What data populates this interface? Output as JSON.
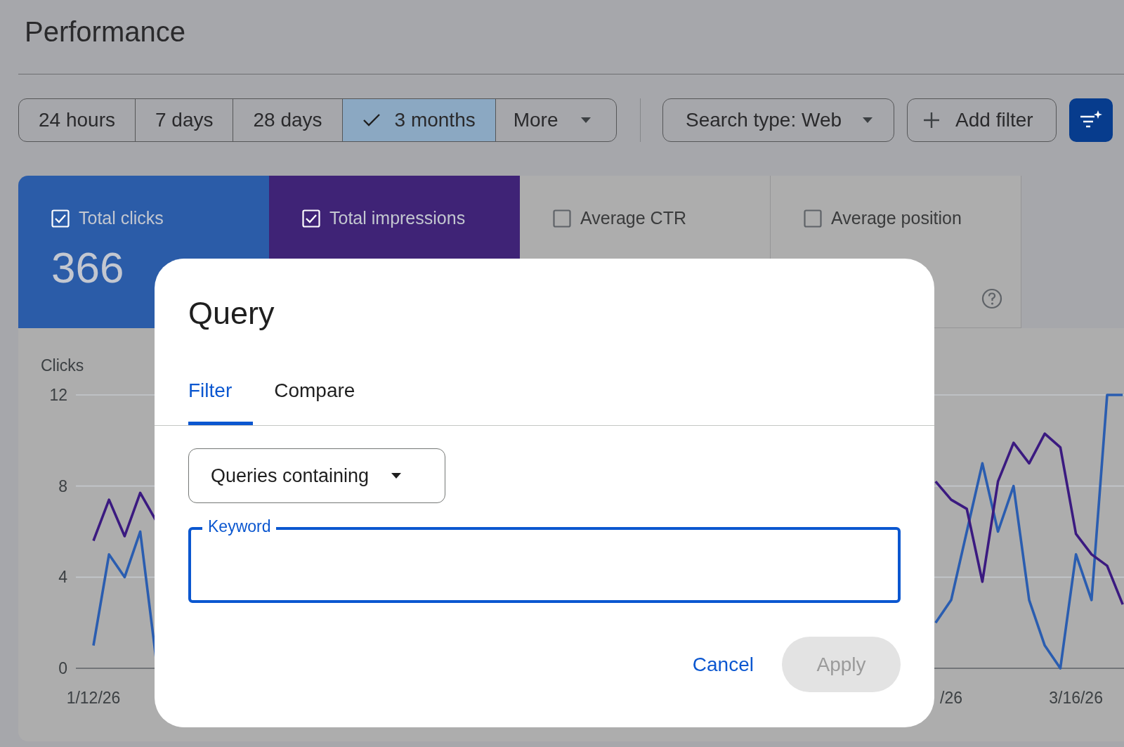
{
  "page": {
    "title": "Performance"
  },
  "date_ranges": [
    {
      "label": "24 hours",
      "selected": false
    },
    {
      "label": "7 days",
      "selected": false
    },
    {
      "label": "28 days",
      "selected": false
    },
    {
      "label": "3 months",
      "selected": true
    }
  ],
  "more_button": {
    "label": "More"
  },
  "search_type": {
    "label": "Search type: Web"
  },
  "add_filter": {
    "label": "Add filter"
  },
  "metrics": [
    {
      "label": "Total clicks",
      "checked": true,
      "value": "366",
      "color": "#2b5ca8",
      "help": false
    },
    {
      "label": "Total impressions",
      "checked": true,
      "color": "#3f2376",
      "help": false
    },
    {
      "label": "Average CTR",
      "checked": false,
      "help": false
    },
    {
      "label": "Average position",
      "checked": false,
      "help": true
    }
  ],
  "chart": {
    "chart_data": {
      "type": "line",
      "ylabel": "Clicks",
      "ylim": [
        0,
        12
      ],
      "yticks": [
        0,
        4,
        8,
        12
      ],
      "categories": [
        "1/12/26",
        null,
        null,
        null,
        null,
        null,
        null,
        null,
        null,
        null,
        null,
        null,
        null,
        null,
        null,
        null,
        null,
        null,
        null,
        null,
        null,
        null,
        null,
        null,
        null,
        null,
        null,
        null,
        null,
        null,
        null,
        null,
        null,
        null,
        null,
        null,
        null,
        null,
        null,
        null,
        null,
        null,
        null,
        null,
        null,
        null,
        null,
        null,
        null,
        null,
        null,
        null,
        null,
        null,
        null,
        "/26",
        null,
        null,
        null,
        null,
        null,
        null,
        null,
        "3/16/26",
        null,
        null,
        null
      ],
      "series": [
        {
          "color": "#2a5db0",
          "values": [
            1,
            5,
            4,
            6,
            0.5,
            null,
            null,
            null,
            null,
            null,
            null,
            null,
            null,
            null,
            null,
            null,
            null,
            null,
            null,
            null,
            null,
            null,
            null,
            null,
            null,
            null,
            null,
            null,
            null,
            null,
            null,
            null,
            null,
            null,
            null,
            null,
            null,
            null,
            null,
            null,
            null,
            null,
            null,
            null,
            null,
            null,
            null,
            null,
            null,
            null,
            null,
            null,
            null,
            null,
            2,
            3,
            6,
            9,
            6,
            8,
            3,
            1,
            0,
            5,
            3,
            12,
            12
          ]
        },
        {
          "color": "#3b1a80",
          "values": [
            5.6,
            7.4,
            5.8,
            7.7,
            6.5,
            null,
            null,
            null,
            null,
            null,
            null,
            null,
            null,
            null,
            null,
            null,
            null,
            null,
            null,
            null,
            null,
            null,
            null,
            null,
            null,
            null,
            null,
            null,
            null,
            null,
            null,
            null,
            null,
            null,
            null,
            null,
            null,
            null,
            null,
            null,
            null,
            null,
            null,
            null,
            null,
            null,
            null,
            null,
            null,
            null,
            null,
            null,
            null,
            null,
            8.2,
            7.4,
            7.0,
            3.8,
            8.2,
            9.9,
            9.0,
            10.3,
            9.7,
            5.9,
            5.0,
            4.5,
            2.8
          ]
        }
      ]
    }
  },
  "dialog": {
    "title": "Query",
    "tabs": [
      {
        "label": "Filter",
        "selected": true
      },
      {
        "label": "Compare",
        "selected": false
      }
    ],
    "match_select": {
      "value": "Queries containing"
    },
    "keyword_field": {
      "label": "Keyword",
      "focused": true
    },
    "buttons": [
      {
        "label": "Cancel",
        "kind": "text",
        "disabled": false
      },
      {
        "label": "Apply",
        "kind": "filled",
        "disabled": true
      }
    ]
  }
}
